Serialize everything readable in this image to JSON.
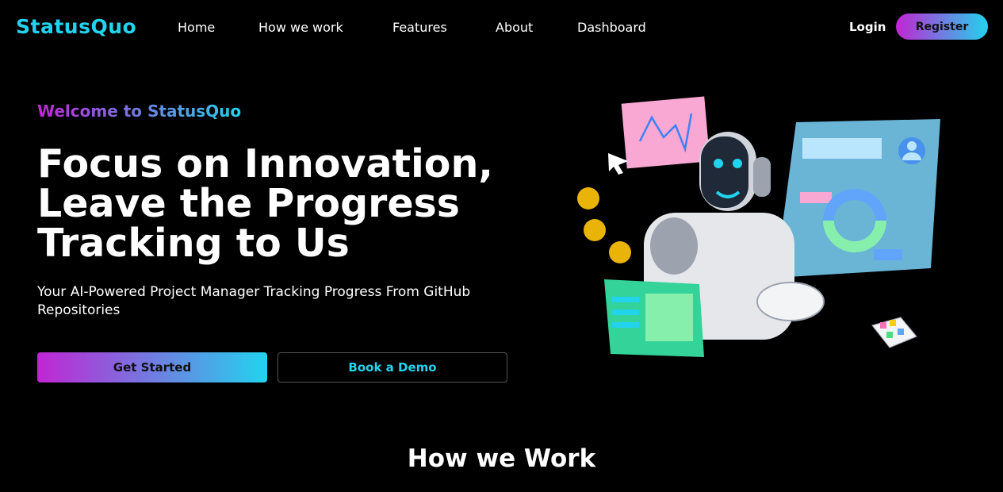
{
  "nav": {
    "logo": "StatusQuo",
    "links": [
      "Home",
      "How we work",
      "Features",
      "About",
      "Dashboard"
    ],
    "login": "Login",
    "register": "Register"
  },
  "hero": {
    "welcome": "Welcome to StatusQuo",
    "headline": [
      "Focus on Innovation,",
      "Leave the Progress",
      "Tracking to Us"
    ],
    "subtitle": "Your AI-Powered Project Manager Tracking Progress From GitHub Repositories",
    "primary_button": "Get Started",
    "secondary_button": "Book a Demo",
    "illustration": "robot-dashboard-illustration"
  },
  "sections": {
    "how_we_work_title": "How we Work"
  },
  "colors": {
    "background": "#000000",
    "accent_cyan": "#22d3ee",
    "accent_magenta": "#c026d3"
  }
}
